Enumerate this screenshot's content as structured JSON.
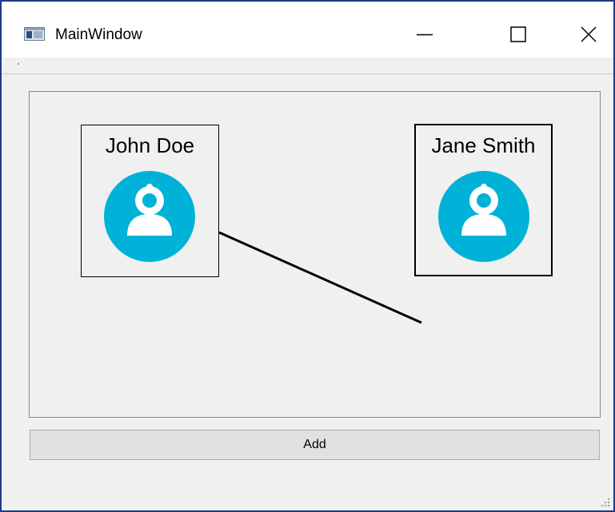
{
  "window": {
    "title": "MainWindow",
    "border_color": "#1c3a8a",
    "controls": {
      "minimize_icon": "minimize-icon",
      "maximize_icon": "maximize-icon",
      "close_icon": "close-icon"
    }
  },
  "graph": {
    "nodes": [
      {
        "name": "John Doe",
        "icon": "user-avatar-icon",
        "selected": false
      },
      {
        "name": "Jane Smith",
        "icon": "user-avatar-icon",
        "selected": true
      }
    ],
    "avatar_color": "#00b2d8",
    "link_color": "#000000"
  },
  "actions": {
    "add_label": "Add"
  }
}
